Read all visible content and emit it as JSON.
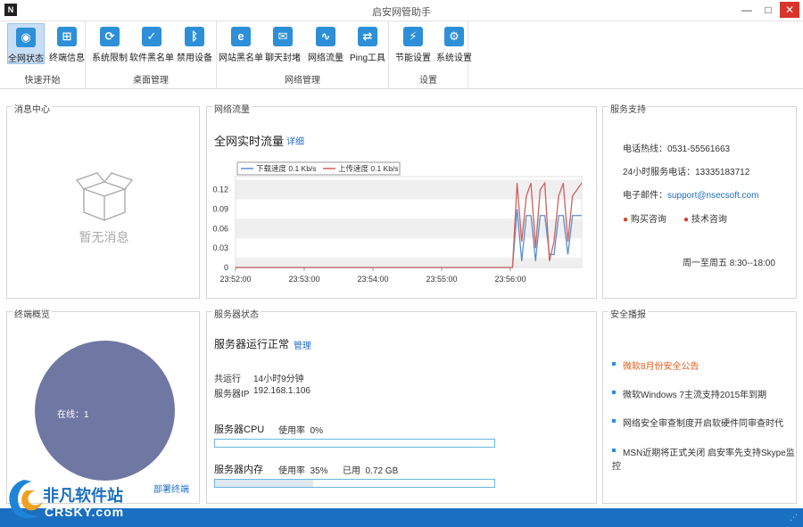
{
  "window": {
    "title": "启安网管助手",
    "app_icon": "N",
    "minimize": "—",
    "maximize": "□",
    "close": "✕"
  },
  "ribbon": {
    "groups": [
      {
        "label": "快速开始",
        "items": [
          {
            "label": "全网状态",
            "icon": "globe-icon",
            "glyph": "◉",
            "active": true
          },
          {
            "label": "终端信息",
            "icon": "windows-icon",
            "glyph": "⊞"
          }
        ]
      },
      {
        "label": "桌面管理",
        "items": [
          {
            "label": "系统限制",
            "icon": "restrict-icon",
            "glyph": "⟳"
          },
          {
            "label": "软件黑名单",
            "icon": "check-icon",
            "glyph": "✓"
          },
          {
            "label": "禁用设备",
            "icon": "bluetooth-icon",
            "glyph": "ᛒ"
          }
        ]
      },
      {
        "label": "网络管理",
        "items": [
          {
            "label": "网站黑名单",
            "icon": "ie-icon",
            "glyph": "e"
          },
          {
            "label": "聊天封堵",
            "icon": "chat-icon",
            "glyph": "✉"
          },
          {
            "label": "网络流量",
            "icon": "pulse-icon",
            "glyph": "∿"
          },
          {
            "label": "Ping工具",
            "icon": "ping-icon",
            "glyph": "⇄"
          }
        ]
      },
      {
        "label": "设置",
        "items": [
          {
            "label": "节能设置",
            "icon": "energy-icon",
            "glyph": "⚡"
          },
          {
            "label": "系统设置",
            "icon": "gear-icon",
            "glyph": "⚙"
          }
        ]
      }
    ]
  },
  "messages": {
    "title": "消息中心",
    "empty_text": "暂无消息"
  },
  "traffic": {
    "title": "网络流量",
    "heading": "全网实时流量",
    "detail_link": "详细"
  },
  "support": {
    "title": "服务支持",
    "hotline": "电话热线：0531-55561663",
    "service_phone": "24小时服务电话：13335183712",
    "email_label": "电子邮件：",
    "email": "support@nsecsoft.com",
    "buy": "购买咨询",
    "tech": "技术咨询",
    "hours": "周一至周五 8:30--18:00"
  },
  "terminal": {
    "title": "终端概览",
    "online": "在线：1",
    "deploy_link": "部署终端",
    "online_fraction": 1.0
  },
  "server": {
    "title": "服务器状态",
    "status": "服务器运行正常",
    "manage_link": "管理",
    "uptime_label": "共运行",
    "uptime": "14小时9分钟",
    "ip_label": "服务器IP",
    "ip": "192.168.1.106",
    "cpu_label": "服务器CPU",
    "cpu_usage": "使用率  0%",
    "cpu_percent": 0,
    "mem_label": "服务器内存",
    "mem_usage": "使用率  35%",
    "mem_used": "已用  0.72 GB",
    "mem_percent": 35
  },
  "security": {
    "title": "安全播报",
    "items": [
      {
        "text": "微软8月份安全公告",
        "color": "#e05a1c"
      },
      {
        "text": "微软Windows 7主流支持2015年到期",
        "color": "#333333"
      },
      {
        "text": "网络安全审查制度开启软硬件同审查时代",
        "color": "#333333"
      },
      {
        "text": "MSN近期将正式关闭 启安率先支持Skype监控",
        "color": "#333333"
      }
    ]
  },
  "watermark": {
    "cn": "非凡软件站",
    "en": "CRSKY.com"
  },
  "chart_data": {
    "type": "line",
    "yticks": [
      "0.12",
      "0.09",
      "0.06",
      "0.03",
      "0"
    ],
    "ylim": [
      0,
      0.14
    ],
    "xticks": [
      "23:52:00",
      "23:53:00",
      "23:54:00",
      "23:55:00",
      "23:56:00"
    ],
    "xlim": [
      0,
      300
    ],
    "series": [
      {
        "name": "下载速度 0.1 Kb/s",
        "color": "#5b8fd0",
        "x": [
          0,
          240,
          244,
          248,
          252,
          256,
          260,
          264,
          268,
          272,
          276,
          280,
          284,
          288,
          292,
          296,
          300
        ],
        "values": [
          0,
          0,
          0.09,
          0.01,
          0.08,
          0.08,
          0.01,
          0.08,
          0.08,
          0.02,
          0.02,
          0.08,
          0.08,
          0.02,
          0.08,
          0.08,
          0.08
        ]
      },
      {
        "name": "上传速度 0.1 Kb/s",
        "color": "#d06060",
        "x": [
          0,
          240,
          244,
          248,
          252,
          256,
          260,
          264,
          268,
          272,
          276,
          280,
          284,
          288,
          292,
          296,
          300
        ],
        "values": [
          0,
          0,
          0.13,
          0.04,
          0.11,
          0.13,
          0.03,
          0.12,
          0.13,
          0.01,
          0.04,
          0.11,
          0.13,
          0.04,
          0.11,
          0.12,
          0.13
        ]
      }
    ]
  }
}
